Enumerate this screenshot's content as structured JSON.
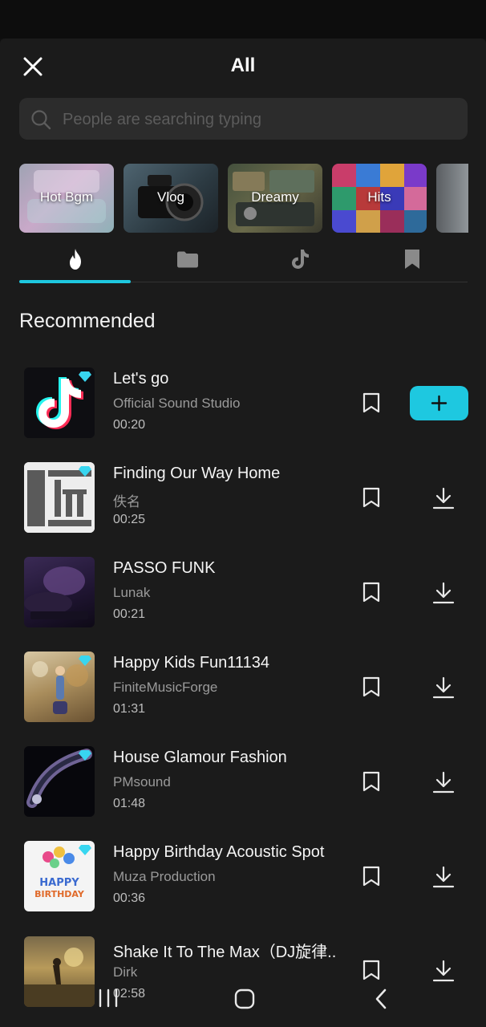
{
  "header": {
    "title": "All"
  },
  "search": {
    "placeholder": "People are searching typing"
  },
  "categories": [
    {
      "label": "Hot Bgm"
    },
    {
      "label": "Vlog"
    },
    {
      "label": "Dreamy"
    },
    {
      "label": "Hits"
    },
    {
      "label": ""
    }
  ],
  "tabs": [
    {
      "icon": "flame-icon",
      "active": true
    },
    {
      "icon": "folder-icon",
      "active": false
    },
    {
      "icon": "tiktok-icon",
      "active": false
    },
    {
      "icon": "bookmark-icon",
      "active": false
    }
  ],
  "section": {
    "title": "Recommended"
  },
  "songs": [
    {
      "title": "Let's go",
      "artist": "Official Sound Studio",
      "duration": "00:20",
      "premium": true,
      "action": "add"
    },
    {
      "title": "Finding Our Way Home",
      "artist": "佚名",
      "duration": "00:25",
      "premium": true,
      "action": "download"
    },
    {
      "title": "PASSO FUNK",
      "artist": "Lunak",
      "duration": "00:21",
      "premium": false,
      "action": "download"
    },
    {
      "title": "Happy Kids Fun11134",
      "artist": "FiniteMusicForge",
      "duration": "01:31",
      "premium": true,
      "action": "download"
    },
    {
      "title": "House Glamour Fashion",
      "artist": "PMsound",
      "duration": "01:48",
      "premium": true,
      "action": "download"
    },
    {
      "title": "Happy Birthday Acoustic Spot",
      "artist": "Muza Production",
      "duration": "00:36",
      "premium": true,
      "action": "download"
    },
    {
      "title": "Shake It To The Max（DJ旋律..",
      "artist": "Dirk",
      "duration": "02:58",
      "premium": false,
      "action": "download"
    }
  ],
  "thumb_art": {
    "happy_birthday_text_1": "HAPPY",
    "happy_birthday_text_2": "BIRTHDAY"
  },
  "colors": {
    "accent": "#1ec8e0",
    "background": "#1b1b1b",
    "search_bg": "#2c2c2c",
    "secondary_text": "#9a9a9a"
  },
  "navbar": [
    {
      "icon": "recent-apps-icon"
    },
    {
      "icon": "home-icon"
    },
    {
      "icon": "back-icon"
    }
  ]
}
